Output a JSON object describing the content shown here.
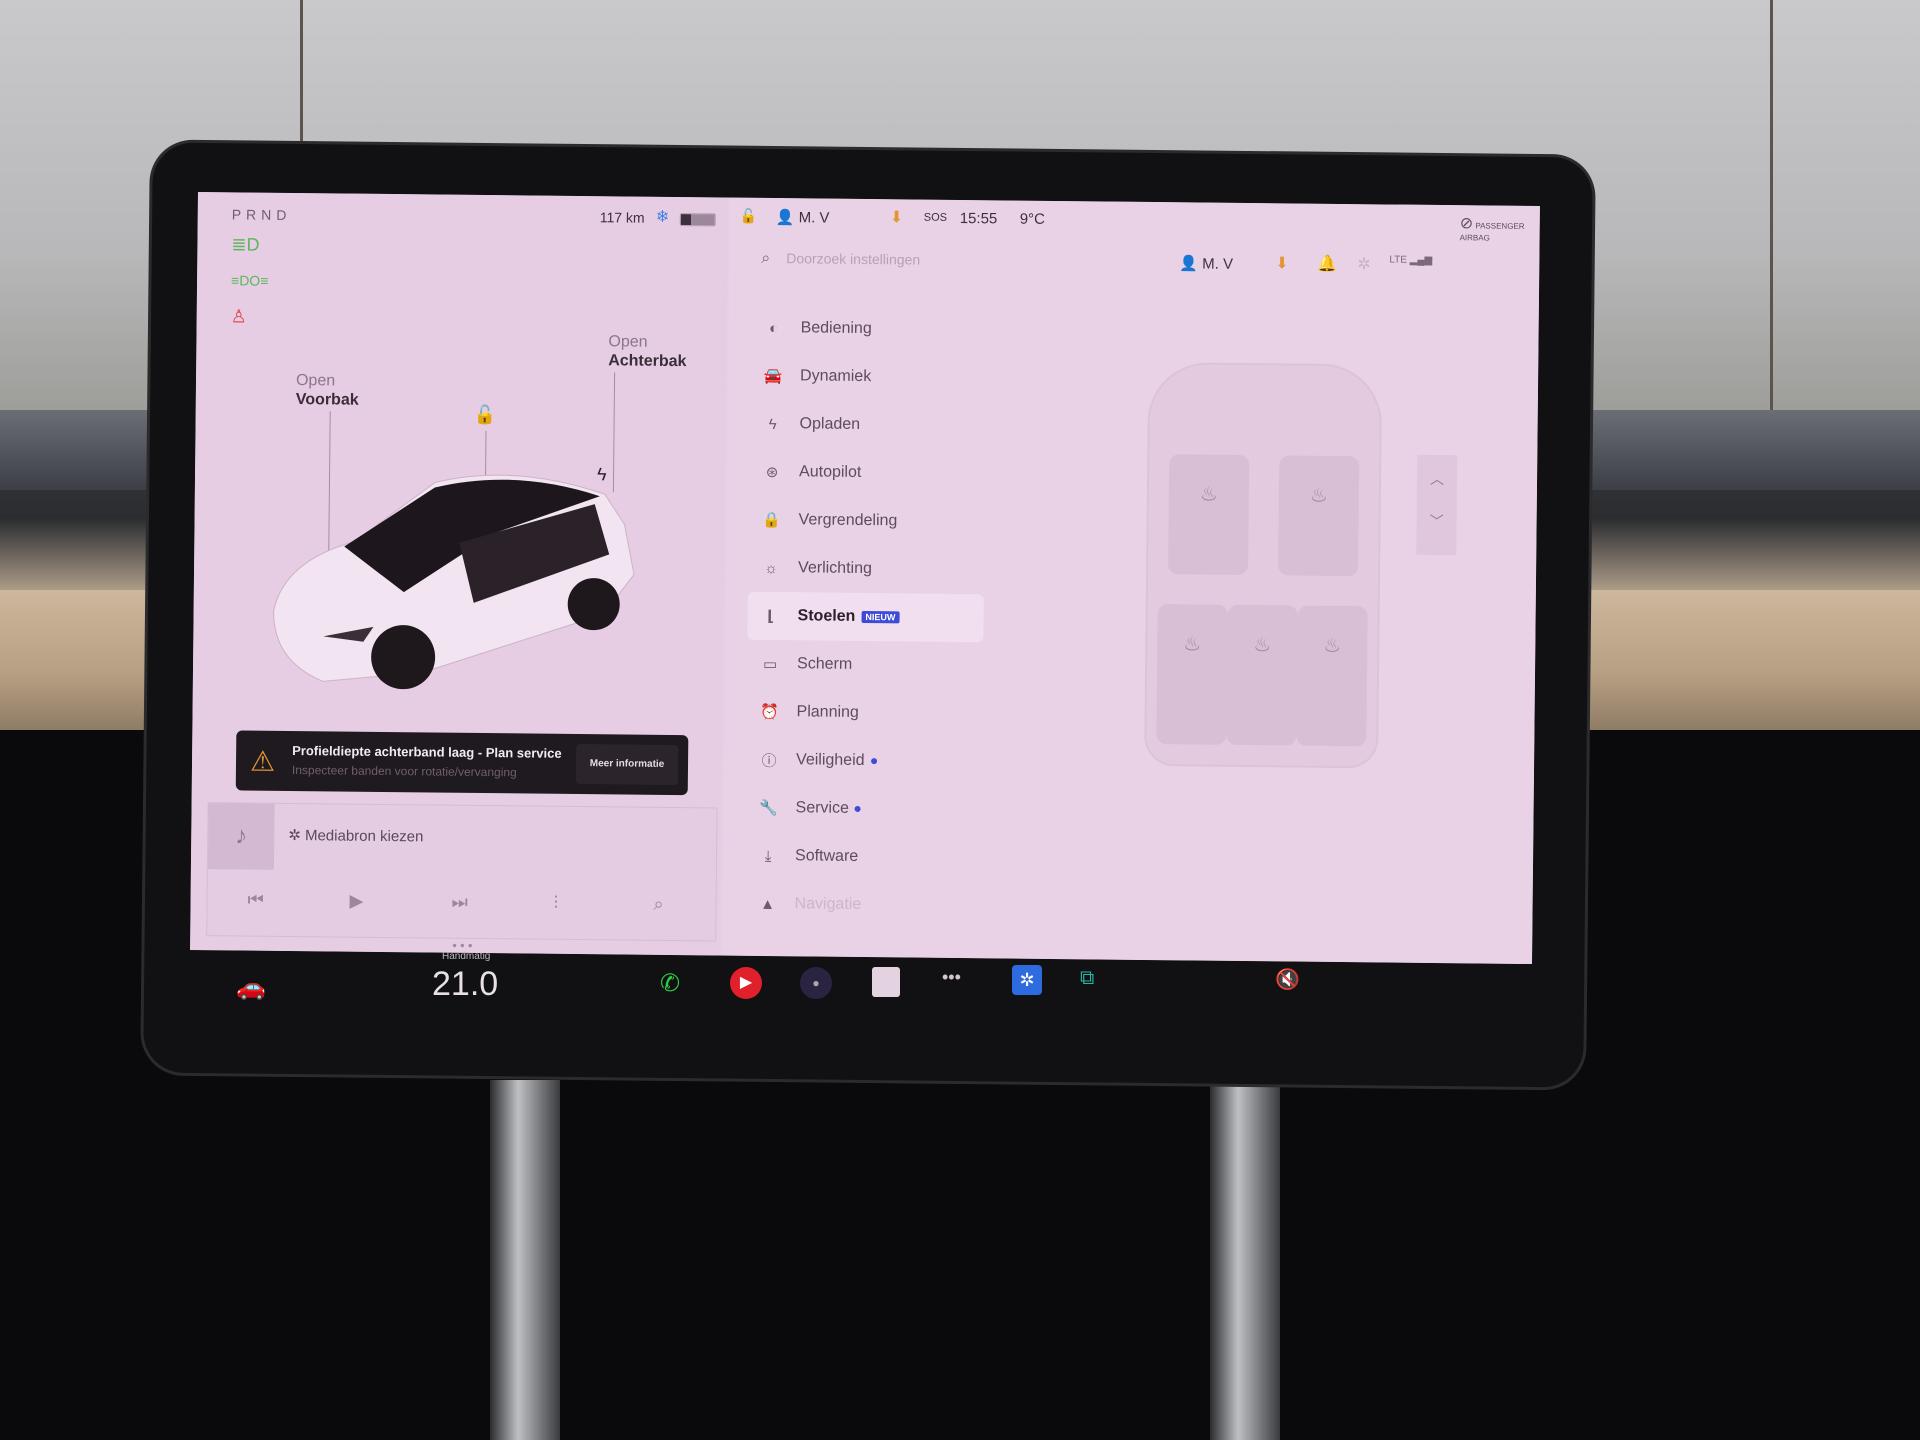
{
  "status_bar": {
    "gear": "PRND",
    "range": "117 km",
    "lock_state": "unlocked",
    "profile": "M. V",
    "sos": "SOS",
    "time": "15:55",
    "temperature": "9°C",
    "airbag": "PASSENGER AIRBAG"
  },
  "telltales": [
    "headlight-icon",
    "parking-light-icon",
    "seatbelt-warning-icon"
  ],
  "car_panel": {
    "frunk_state": "Open",
    "frunk_label": "Voorbak",
    "trunk_state": "Open",
    "trunk_label": "Achterbak"
  },
  "alert": {
    "title": "Profieldiepte achterband laag - Plan service",
    "subtitle": "Inspecteer banden voor rotatie/vervanging",
    "button": "Meer informatie"
  },
  "media": {
    "source": "Mediabron kiezen",
    "controls": [
      "previous",
      "play",
      "next",
      "equalizer",
      "search"
    ]
  },
  "settings": {
    "search_placeholder": "Doorzoek instellingen",
    "profile": "M. V",
    "network": "LTE",
    "menu": [
      {
        "label": "Bediening",
        "icon": "toggle-icon"
      },
      {
        "label": "Dynamiek",
        "icon": "car-icon"
      },
      {
        "label": "Opladen",
        "icon": "bolt-icon"
      },
      {
        "label": "Autopilot",
        "icon": "steering-wheel-icon"
      },
      {
        "label": "Vergrendeling",
        "icon": "lock-icon"
      },
      {
        "label": "Verlichting",
        "icon": "sun-icon"
      },
      {
        "label": "Stoelen",
        "icon": "seat-icon",
        "badge": "NIEUW",
        "active": true
      },
      {
        "label": "Scherm",
        "icon": "display-icon"
      },
      {
        "label": "Planning",
        "icon": "alarm-icon"
      },
      {
        "label": "Veiligheid",
        "icon": "info-icon",
        "dot": true
      },
      {
        "label": "Service",
        "icon": "wrench-icon",
        "dot": true
      },
      {
        "label": "Software",
        "icon": "download-icon"
      },
      {
        "label": "Navigatie",
        "icon": "navigation-icon"
      }
    ],
    "seat_heaters": [
      "front-left",
      "front-right",
      "rear-left",
      "rear-center",
      "rear-right"
    ]
  },
  "taskbar": {
    "climate_mode": "Handmatig",
    "cabin_temp": "21.0",
    "apps": [
      "phone",
      "music",
      "camera",
      "notes",
      "more",
      "bluetooth",
      "toybox"
    ],
    "volume": "muted"
  },
  "colors": {
    "accent": "#3d4bd6",
    "alert": "#e59431",
    "screen": "#e7cfe4"
  }
}
